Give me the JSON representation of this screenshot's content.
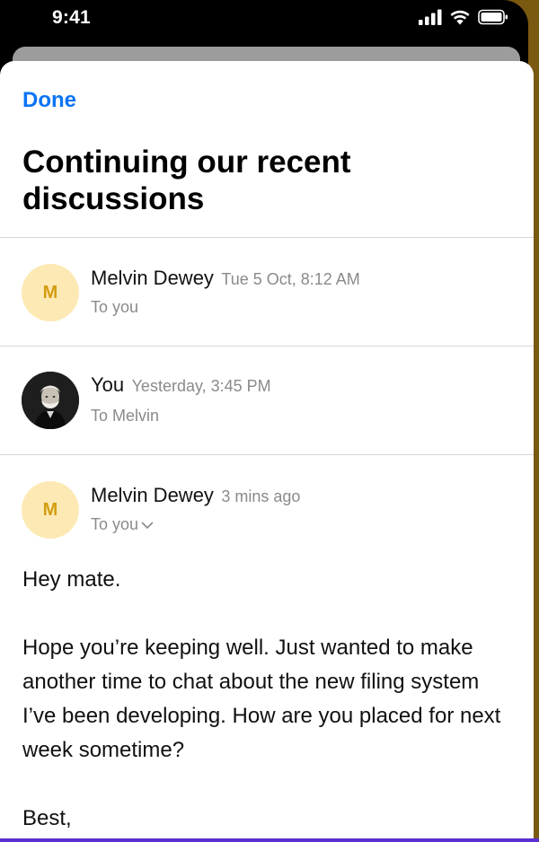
{
  "status_bar": {
    "time": "9:41"
  },
  "header": {
    "done_label": "Done",
    "title": "Continuing our recent discussions"
  },
  "messages": [
    {
      "avatar_initial": "M",
      "sender": "Melvin Dewey",
      "time": "Tue 5 Oct, 8:12 AM",
      "recipient": "To you"
    },
    {
      "sender": "You",
      "time": "Yesterday, 3:45 PM",
      "recipient": "To Melvin"
    },
    {
      "avatar_initial": "M",
      "sender": "Melvin Dewey",
      "time": "3 mins ago",
      "recipient": "To you"
    }
  ],
  "email_body": {
    "greeting": "Hey mate.",
    "paragraph": "Hope you’re keeping well. Just wanted to make another time to chat about the new filing system I’ve been developing. How are you placed for next week sometime?",
    "signoff": "Best,"
  },
  "colors": {
    "accent": "#0a74f5",
    "avatar_bg": "#fde9b4",
    "avatar_text": "#d39d10"
  }
}
